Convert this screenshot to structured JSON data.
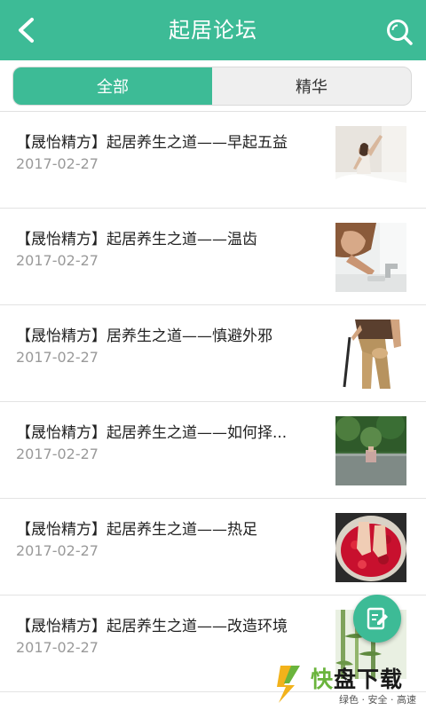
{
  "header": {
    "title": "起居论坛",
    "back_icon": "chevron-left-icon",
    "search_icon": "search-icon",
    "bg_color": "#3dbb96"
  },
  "tabs": [
    {
      "label": "全部",
      "active": true
    },
    {
      "label": "精华",
      "active": false
    }
  ],
  "posts": [
    {
      "title": "【晟怡精方】起居养生之道——早起五益",
      "date": "2017-02-27",
      "thumb": "woman-stretching-photo"
    },
    {
      "title": "【晟怡精方】起居养生之道——温齿",
      "date": "2017-02-27",
      "thumb": "brushing-teeth-photo"
    },
    {
      "title": "【晟怡精方】居养生之道——慎避外邪",
      "date": "2017-02-27",
      "thumb": "knee-pain-photo"
    },
    {
      "title": "【晟怡精方】起居养生之道——如何择...",
      "date": "2017-02-27",
      "thumb": "park-bridge-photo"
    },
    {
      "title": "【晟怡精方】起居养生之道——热足",
      "date": "2017-02-27",
      "thumb": "foot-bath-petals-photo"
    },
    {
      "title": "【晟怡精方】起居养生之道——改造环境",
      "date": "2017-02-27",
      "thumb": "bamboo-photo"
    }
  ],
  "fab": {
    "icon": "edit-post-icon"
  },
  "watermark": {
    "brand_green": "快",
    "brand_dark": "盘下载",
    "tagline": "绿色 · 安全 · 高速"
  },
  "colors": {
    "accent": "#3dbb96",
    "date": "#9a9a9a",
    "title": "#222222"
  }
}
